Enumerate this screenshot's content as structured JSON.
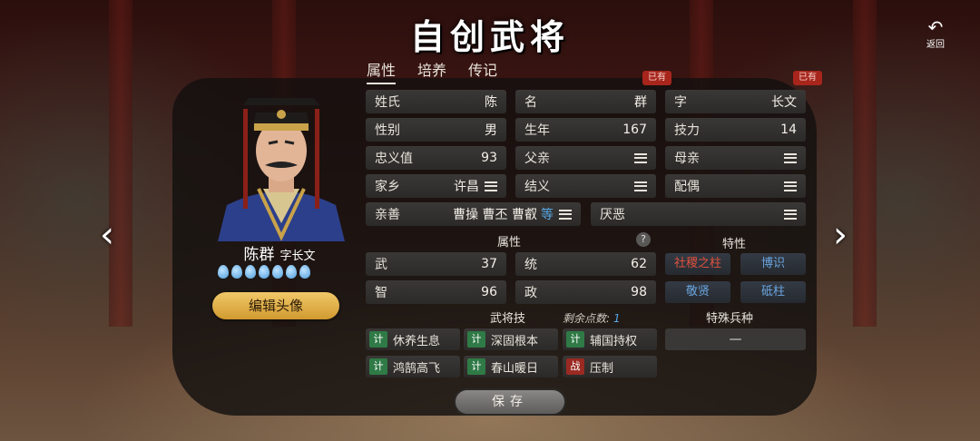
{
  "header": {
    "title": "自创武将",
    "back_label": "返回"
  },
  "tabs": [
    {
      "label": "属性",
      "active": true
    },
    {
      "label": "培养",
      "active": false
    },
    {
      "label": "传记",
      "active": false
    }
  ],
  "character": {
    "display_name": "陈群",
    "courtesy_line": "字长文",
    "drops_count": 7,
    "edit_avatar_label": "编辑头像"
  },
  "badges": {
    "name_exists": "已有",
    "courtesy_exists": "已有"
  },
  "fields": {
    "surname": {
      "label": "姓氏",
      "value": "陈"
    },
    "given_name": {
      "label": "名",
      "value": "群"
    },
    "courtesy": {
      "label": "字",
      "value": "长文"
    },
    "gender": {
      "label": "性别",
      "value": "男"
    },
    "birth_year": {
      "label": "生年",
      "value": "167"
    },
    "skill_power": {
      "label": "技力",
      "value": "14"
    },
    "loyalty": {
      "label": "忠义值",
      "value": "93"
    },
    "father": {
      "label": "父亲",
      "value": ""
    },
    "mother": {
      "label": "母亲",
      "value": ""
    },
    "hometown": {
      "label": "家乡",
      "value": "许昌"
    },
    "sworn": {
      "label": "结义",
      "value": ""
    },
    "spouse": {
      "label": "配偶",
      "value": ""
    },
    "friendly": {
      "label": "亲善",
      "value": "曹操 曹丕 曹叡",
      "etc": "等"
    },
    "hostile": {
      "label": "厌恶",
      "value": ""
    }
  },
  "attributes": {
    "section_label": "属性",
    "help": "?",
    "items": [
      {
        "label": "武",
        "value": "37"
      },
      {
        "label": "统",
        "value": "62"
      },
      {
        "label": "智",
        "value": "96"
      },
      {
        "label": "政",
        "value": "98"
      }
    ]
  },
  "traits": {
    "section_label": "特性",
    "items": [
      {
        "label": "社稷之柱",
        "color": "#e0523e"
      },
      {
        "label": "博识",
        "color": "#6aa6e0"
      },
      {
        "label": "敬贤",
        "color": "#6aa6e0"
      },
      {
        "label": "砥柱",
        "color": "#6aa6e0"
      }
    ]
  },
  "skills": {
    "section_label": "武将技",
    "remaining_label": "剩余点数:",
    "remaining_value": "1",
    "items": [
      {
        "tag": "计",
        "label": "休养生息",
        "tag_color": "#2f7a46"
      },
      {
        "tag": "计",
        "label": "深固根本",
        "tag_color": "#2f7a46"
      },
      {
        "tag": "计",
        "label": "辅国持权",
        "tag_color": "#2f7a46"
      },
      {
        "tag": "计",
        "label": "鸿鹄高飞",
        "tag_color": "#2f7a46"
      },
      {
        "tag": "计",
        "label": "春山暖日",
        "tag_color": "#2f7a46"
      },
      {
        "tag": "战",
        "label": "压制",
        "tag_color": "#9a2a22"
      }
    ]
  },
  "special_troop": {
    "section_label": "特殊兵种",
    "value": "—"
  },
  "save_label": "保存",
  "icons": [
    "back-icon",
    "left-arrow-icon",
    "right-arrow-icon",
    "menu-icon",
    "water-drop-icon",
    "help-icon"
  ]
}
